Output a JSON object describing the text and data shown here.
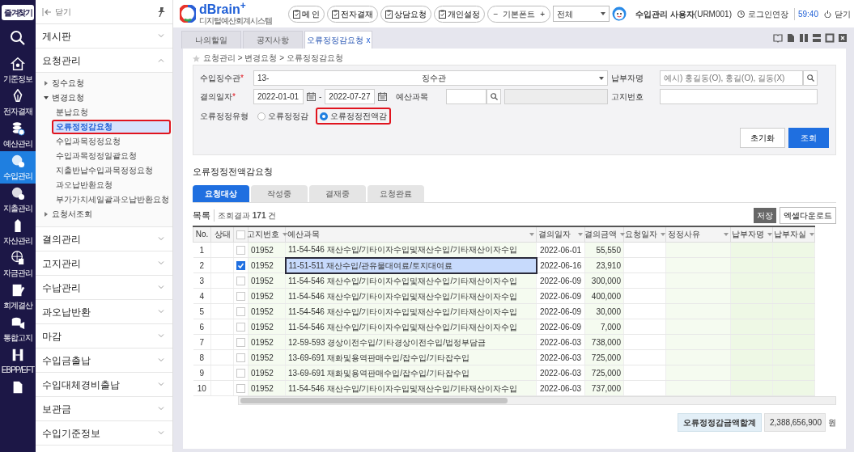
{
  "rail": {
    "favorites": "즐겨찾기",
    "items": [
      {
        "label": "기준정보",
        "selected": false
      },
      {
        "label": "전자결재",
        "selected": false
      },
      {
        "label": "예산관리",
        "selected": false
      },
      {
        "label": "수입관리",
        "selected": true
      },
      {
        "label": "지출관리",
        "selected": false
      },
      {
        "label": "자산관리",
        "selected": false
      },
      {
        "label": "자금관리",
        "selected": false
      },
      {
        "label": "회계결산",
        "selected": false
      },
      {
        "label": "통합고지",
        "selected": false
      },
      {
        "label": "EBPP/EFT",
        "selected": false
      },
      {
        "selected": false
      }
    ]
  },
  "sidebar": {
    "close": "닫기",
    "menu": [
      {
        "label": "게시판",
        "expanded": false
      },
      {
        "label": "요청관리",
        "expanded": true,
        "children": [
          {
            "label": "징수요청",
            "expanded": false
          },
          {
            "label": "변경요청",
            "expanded": true,
            "children": [
              {
                "label": "분납요청",
                "selected": false,
                "highlighted": false
              },
              {
                "label": "오류정정감요청",
                "selected": true,
                "highlighted": true
              },
              {
                "label": "수입과목정정요청",
                "selected": false,
                "highlighted": false
              },
              {
                "label": "수입과목정정일괄요청",
                "selected": false,
                "highlighted": false
              },
              {
                "label": "지출반납수입과목정정요청",
                "selected": false,
                "highlighted": false
              },
              {
                "label": "과오납반환요청",
                "selected": false,
                "highlighted": false
              },
              {
                "label": "부가가치세일괄과오납반환요청",
                "selected": false,
                "highlighted": false
              }
            ]
          },
          {
            "label": "요청서조회",
            "expanded": false
          }
        ]
      },
      {
        "label": "결의관리",
        "expanded": false
      },
      {
        "label": "고지관리",
        "expanded": false
      },
      {
        "label": "수납관리",
        "expanded": false
      },
      {
        "label": "과오납반환",
        "expanded": false
      },
      {
        "label": "마감",
        "expanded": false
      },
      {
        "label": "수입금출납",
        "expanded": false
      },
      {
        "label": "수입대체경비출납",
        "expanded": false
      },
      {
        "label": "보관금",
        "expanded": false
      },
      {
        "label": "수입기준정보",
        "expanded": false
      }
    ]
  },
  "header": {
    "logo": "dBrain$^{+}$",
    "logo_subtitle": "디지털예산회계시스템",
    "buttons": [
      "메 인",
      "전자결재",
      "상담요청",
      "개인설정"
    ],
    "font_control": {
      "minus": "−",
      "label": "기본폰트",
      "plus": "+"
    },
    "scope_select": "전체",
    "user": "**수입관리 사용자**(URM001)",
    "extend_login": "로그인연장",
    "timer": "59:40",
    "logout": "닫기"
  },
  "tabs": [
    {
      "label": "나의할일",
      "selected": false
    },
    {
      "label": "공지사항",
      "selected": false
    },
    {
      "label": "오류정정감요청",
      "selected": true,
      "close": "x"
    }
  ],
  "breadcrumb": "요청관리 > 변경요청 > 오류정정감요청",
  "filters": {
    "collector": {
      "label": "수입징수관",
      "required_mark": "*",
      "code": "13-",
      "value": "징수관"
    },
    "payer": {
      "label": "납부자명",
      "placeholder": "예시) 홍길동(O), 홍길(O), 길동(X)"
    },
    "date": {
      "label": "결의일자",
      "required_mark": "*",
      "from": "2022-01-01",
      "separator": "-",
      "to": "2022-07-27"
    },
    "budget": {
      "label": "예산과목"
    },
    "notice": {
      "label": "고지번호"
    },
    "type": {
      "label": "오류정정유형",
      "options": [
        {
          "label": "오류정정감",
          "selected": false,
          "highlighted": false
        },
        {
          "label": "오류정정전액감",
          "selected": true,
          "highlighted": true
        }
      ]
    },
    "reset": "초기화",
    "search": "조회"
  },
  "section_title": "오류정정전액감요청",
  "status_tabs": [
    {
      "label": "요청대상",
      "selected": true
    },
    {
      "label": "작성중",
      "selected": false
    },
    {
      "label": "결재중",
      "selected": false
    },
    {
      "label": "요청완료",
      "selected": false
    }
  ],
  "list": {
    "title": "목록",
    "summary": "조회결과 **171** 건",
    "save": "저장",
    "excel": "엑셀다운로드"
  },
  "table": {
    "columns": [
      {
        "label": "No.",
        "filter": false
      },
      {
        "label": "상태",
        "filter": false
      },
      {
        "kind": "checkbox",
        "checked": false
      },
      {
        "label": "고지번호",
        "filter": true
      },
      {
        "label": "예산과목",
        "filter": true
      },
      {
        "label": "결의일자",
        "filter": true
      },
      {
        "label": "결의금액",
        "filter": true
      },
      {
        "label": "요청일자",
        "filter": true
      },
      {
        "label": "정정사유",
        "filter": true
      },
      {
        "label": "납부자명",
        "filter": true
      },
      {
        "label": "납부자실",
        "filter": true
      }
    ],
    "rows": [
      {
        "no": "1",
        "checked": false,
        "notice": "01952",
        "budget": "11-54-546 재산수입/기타이자수입및재산수입/기타재산이자수입",
        "date": "2022-06-01",
        "amount": "55,550",
        "selected": false
      },
      {
        "no": "2",
        "checked": true,
        "notice": "01952",
        "budget": "11-51-511 재산수입/관유물대여료/토지대여료",
        "date": "2022-06-16",
        "amount": "23,910",
        "selected": true
      },
      {
        "no": "3",
        "checked": false,
        "notice": "01952",
        "budget": "11-54-546 재산수입/기타이자수입및재산수입/기타재산이자수입",
        "date": "2022-06-09",
        "amount": "300,000",
        "selected": false
      },
      {
        "no": "4",
        "checked": false,
        "notice": "01952",
        "budget": "11-54-546 재산수입/기타이자수입및재산수입/기타재산이자수입",
        "date": "2022-06-09",
        "amount": "400,000",
        "selected": false
      },
      {
        "no": "5",
        "checked": false,
        "notice": "01952",
        "budget": "11-54-546 재산수입/기타이자수입및재산수입/기타재산이자수입",
        "date": "2022-06-09",
        "amount": "30,000",
        "selected": false
      },
      {
        "no": "6",
        "checked": false,
        "notice": "01952",
        "budget": "11-54-546 재산수입/기타이자수입및재산수입/기타재산이자수입",
        "date": "2022-06-09",
        "amount": "7,000",
        "selected": false
      },
      {
        "no": "7",
        "checked": false,
        "notice": "01952",
        "budget": "12-59-593 경상이전수입/기타경상이전수입/법정부담금",
        "date": "2022-06-03",
        "amount": "738,000",
        "selected": false
      },
      {
        "no": "8",
        "checked": false,
        "notice": "01952",
        "budget": "13-69-691 재화및용역판매수입/잡수입/기타잡수입",
        "date": "2022-06-03",
        "amount": "725,000",
        "selected": false
      },
      {
        "no": "9",
        "checked": false,
        "notice": "01952",
        "budget": "13-69-691 재화및용역판매수입/잡수입/기타잡수입",
        "date": "2022-06-03",
        "amount": "725,000",
        "selected": false
      },
      {
        "no": "10",
        "checked": false,
        "notice": "01952",
        "budget": "11-54-546 재산수입/기타이자수입및재산수입/기타재산이자수입",
        "date": "2022-06-03",
        "amount": "737,000",
        "selected": false
      }
    ]
  },
  "total": {
    "label": "오류정정감금액합계",
    "value": "2,388,656,900",
    "unit": "원"
  }
}
